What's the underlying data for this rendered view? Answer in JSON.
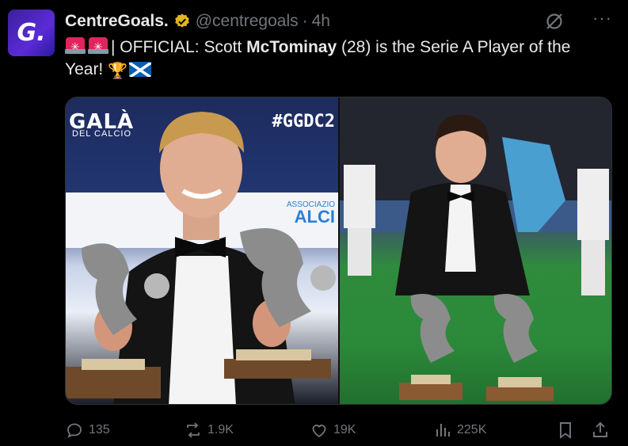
{
  "tweet": {
    "avatar_letter": "G.",
    "author_name": "CentreGoals.",
    "handle": "@centregoals",
    "separator": "·",
    "time": "4h",
    "more_label": "···",
    "text_prefix": "| OFFICIAL: Scott ",
    "text_bold": "McTominay",
    "text_suffix": " (28) is the Serie A Player of the Year! ",
    "trophy_emoji": "🏆"
  },
  "media": {
    "left_gala": "GALÀ",
    "left_gala_sub": "DEL CALCIO",
    "left_hashtag": "#GGDC2",
    "left_sponsor_small": "ASSOCIAZIO",
    "left_sponsor": "ALCI"
  },
  "actions": {
    "replies": "135",
    "reposts": "1.9K",
    "likes": "19K",
    "views": "225K"
  },
  "colors": {
    "background": "#000000",
    "text": "#e7e9ea",
    "muted": "#71767b",
    "verified_gold": "#e2b719"
  },
  "icons": [
    "verified-badge-icon",
    "grok-icon",
    "more-icon",
    "siren-icon",
    "trophy-icon",
    "scotland-flag-icon",
    "reply-icon",
    "repost-icon",
    "like-icon",
    "views-icon",
    "bookmark-icon",
    "share-icon"
  ]
}
